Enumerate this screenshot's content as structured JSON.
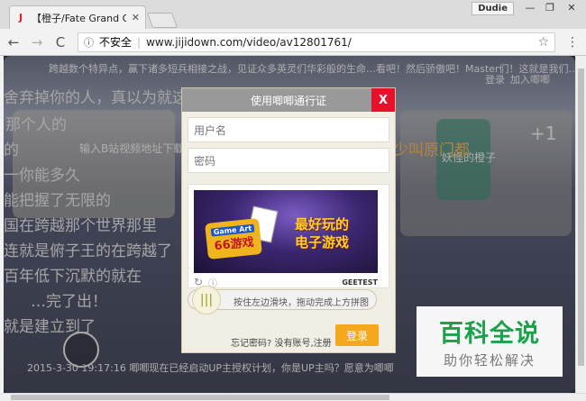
{
  "browser": {
    "tab_title": "【橙子/Fate Grand Ord",
    "tab_close": "✕",
    "user_badge": "Dudie",
    "win_min": "—",
    "win_restore": "❐",
    "win_close": "✕",
    "back": "←",
    "forward": "→",
    "reload": "C",
    "security": "不安全",
    "url": "www.jijidown.com/video/av12801761/",
    "star": "☆",
    "menu": "⋮"
  },
  "page": {
    "bg_lines": [
      "跨越数个特异点，赢下诸多短兵相接之战，见证众多英灵们华彩般的生命…看吧！然后骄傲吧！Master们！这就是我们…",
      "舍弃掉你的人，真以为就这么简单",
      "那个人的",
      "输入B站视频地址下载",
      "的",
      "一你能多久",
      "能把握了无限的",
      "国在跨越那个世界那里",
      "连就是俯子王的在跨越了",
      "百年低下沉默的就在",
      "…完了出！",
      "就是建立到了",
      "2015-3-30 19:17:16 唧唧现在已经启动UP主授权计划，你是UP主吗？愿意为唧唧",
      "登录",
      "加入唧唧",
      "妖怪的橙子",
      "+1",
      "少叫原门都"
    ]
  },
  "modal": {
    "title": "使用唧唧通行证",
    "close": "X",
    "username_placeholder": "用户名",
    "password_placeholder": "密码",
    "ad_logo_top": "Game Art",
    "ad_logo_bottom": "66游戏",
    "ad_slogan": "最好玩的 电子游戏",
    "captcha_refresh": "↻",
    "captcha_info": "ⓘ",
    "captcha_brand": "GEETEST",
    "slider_knob": "|||",
    "slider_hint": "按住左边滑块，拖动完成上方拼图",
    "links": "忘记密码? 没有账号,注册",
    "login_button": "登录"
  },
  "watermark": {
    "title": "百科全说",
    "subtitle": "助你轻松解决"
  },
  "colors": {
    "close_red": "#e8112c",
    "login_orange": "#f3a81e",
    "watermark_green": "#1aa14a"
  }
}
